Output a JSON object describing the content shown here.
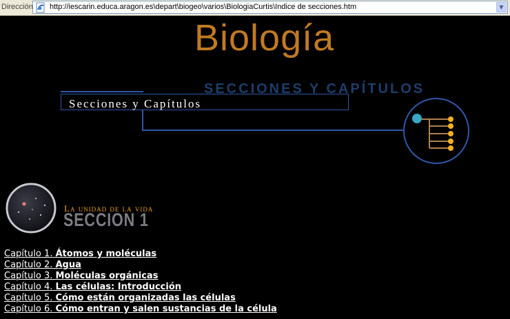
{
  "address_bar": {
    "label": "Dirección",
    "url": "http://iescarin.educa.aragon.es\\depart\\biogeo\\varios\\BiologiaCurtis\\Indice de secciones.htm"
  },
  "page": {
    "title": "Biología",
    "heading_ghost": "SECCIONES Y CAPÍTULOS",
    "heading": "Secciones y Capítulos"
  },
  "section": {
    "subtitle": "La unidad de la vida",
    "title": "SECCION 1"
  },
  "chapters": [
    {
      "prefix": "Capítulo 1.",
      "name": "Átomos y moléculas"
    },
    {
      "prefix": "Capítulo 2.",
      "name": "Agua"
    },
    {
      "prefix": "Capítulo 3.",
      "name": "Moléculas orgánicas"
    },
    {
      "prefix": "Capítulo 4.",
      "name": "Las células: Introducción"
    },
    {
      "prefix": "Capítulo 5.",
      "name": "Cómo están organizadas las células"
    },
    {
      "prefix": "Capítulo 6.",
      "name": "Cómo entran y salen sustancias de la célula"
    }
  ],
  "colors": {
    "title": "#c07a22",
    "accent_blue": "#2f58a8",
    "section_orange": "#f0a020"
  }
}
